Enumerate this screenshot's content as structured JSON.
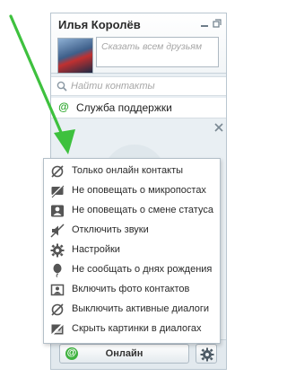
{
  "header": {
    "user_name": "Илья Королёв",
    "status_placeholder": "Сказать всем друзьям"
  },
  "search": {
    "placeholder": "Найти контакты"
  },
  "contacts": [
    {
      "name": "Служба поддержки"
    }
  ],
  "menu": {
    "items": [
      {
        "label": "Только онлайн контакты",
        "icon": "online-only-icon"
      },
      {
        "label": "Не оповещать о микропостах",
        "icon": "mute-microposts-icon"
      },
      {
        "label": "Не оповещать о смене статуса",
        "icon": "mute-status-icon"
      },
      {
        "label": "Отключить звуки",
        "icon": "mute-sounds-icon"
      },
      {
        "label": "Настройки",
        "icon": "gear-icon"
      },
      {
        "label": "Не сообщать о днях рождения",
        "icon": "birthday-balloon-icon"
      },
      {
        "label": "Включить фото контактов",
        "icon": "contact-photo-icon"
      },
      {
        "label": "Выключить активные диалоги",
        "icon": "dialog-off-icon"
      },
      {
        "label": "Скрыть картинки в диалогах",
        "icon": "image-hide-icon"
      }
    ]
  },
  "footer": {
    "status_label": "Онлайн"
  },
  "colors": {
    "accent_green": "#2fa52f",
    "annotation_arrow": "#3ec13e",
    "panel_bg": "#e9eff3"
  }
}
